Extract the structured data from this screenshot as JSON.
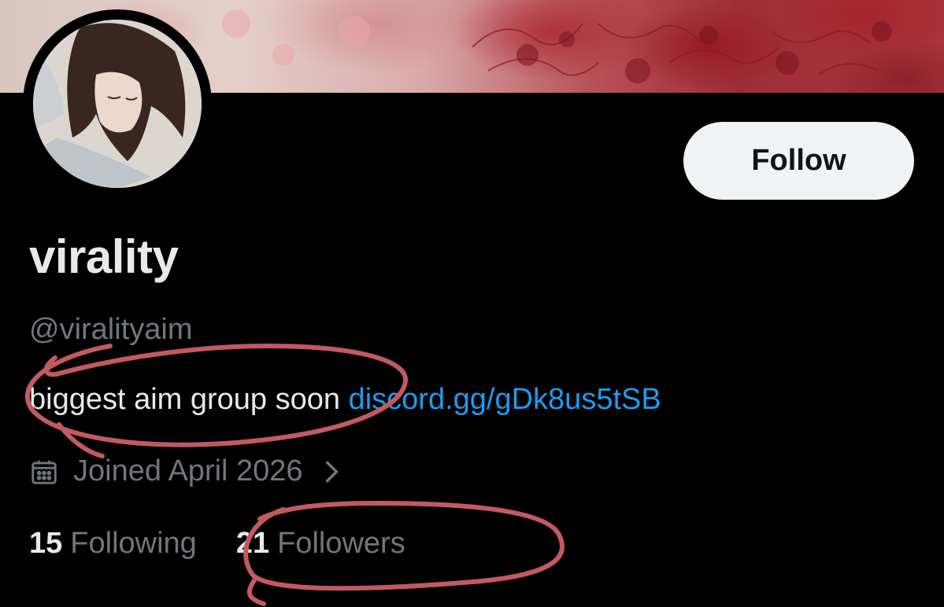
{
  "profile": {
    "display_name": "virality",
    "handle": "@viralityaim",
    "bio_text": "biggest aim group soon ",
    "bio_link": "discord.gg/gDk8us5tSB",
    "joined": "Joined April 2026",
    "follow_label": "Follow"
  },
  "stats": {
    "following_count": "15",
    "following_label": "Following",
    "followers_count": "21",
    "followers_label": "Followers"
  },
  "icons": {
    "calendar": "calendar-icon",
    "chevron": "chevron-right-icon"
  },
  "colors": {
    "background": "#000000",
    "link": "#1d9bf0",
    "secondary_text": "#71767b",
    "annotation": "#c25a60"
  }
}
